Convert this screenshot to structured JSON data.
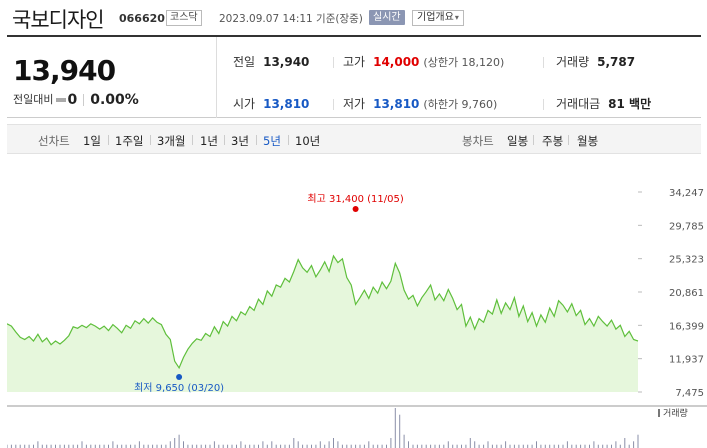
{
  "header": {
    "stock_name": "국보디자인",
    "stock_code": "066620",
    "market": "코스닥",
    "as_of": "2023.09.07 14:11 기준(장중)",
    "realtime_label": "실시간",
    "company_label": "기업개요"
  },
  "price": {
    "current": "13,940",
    "change_label": "전일대비",
    "change_value": "0",
    "change_pct": "0.00%"
  },
  "stats": {
    "prev_close": {
      "label": "전일",
      "value": "13,940"
    },
    "high": {
      "label": "고가",
      "value": "14,000",
      "sub": "(상한가 18,120)"
    },
    "volume": {
      "label": "거래량",
      "value": "5,787"
    },
    "open": {
      "label": "시가",
      "value": "13,810"
    },
    "low": {
      "label": "저가",
      "value": "13,810",
      "sub": "(하한가 9,760)"
    },
    "amount": {
      "label": "거래대금",
      "value": "81 백만"
    }
  },
  "line_chart": {
    "label": "선차트",
    "options": [
      "1일",
      "1주일",
      "3개월",
      "1년",
      "3년",
      "5년",
      "10년"
    ],
    "active": "5년"
  },
  "candle_chart": {
    "label": "봉차트",
    "options": [
      "일봉",
      "주봉",
      "월봉"
    ]
  },
  "colors": {
    "up": "#e00000",
    "down": "#1759c4",
    "line": "#5fbf3c",
    "area": "#e6f7dc"
  },
  "chart_data": {
    "type": "area",
    "series": [
      {
        "values": [
          16600,
          16300,
          15500,
          14800,
          14500,
          14900,
          14300,
          15200,
          14200,
          14700,
          13800,
          14300,
          13900,
          14400,
          15000,
          16200,
          16000,
          16400,
          16100,
          16600,
          16300,
          15900,
          16300,
          15700,
          16500,
          16000,
          15400,
          16400,
          16000,
          17000,
          16600,
          17300,
          16700,
          17400,
          16800,
          16500,
          15200,
          14500,
          11600,
          10700,
          12100,
          13200,
          14000,
          14600,
          14400,
          15300,
          14900,
          16200,
          15300,
          16900,
          16300,
          17600,
          17000,
          18200,
          17800,
          18900,
          18400,
          19900,
          19200,
          21000,
          20300,
          21800,
          21500,
          22700,
          22200,
          23600,
          25200,
          24100,
          23500,
          24400,
          22900,
          23800,
          24900,
          23600,
          25700,
          24800,
          25300,
          22800,
          21800,
          19200,
          20100,
          21100,
          20000,
          21500,
          20700,
          22200,
          21300,
          22300,
          24700,
          23400,
          21100,
          19900,
          20400,
          19000,
          20100,
          20900,
          21800,
          19800,
          20600,
          19700,
          21200,
          20000,
          18500,
          19200,
          16300,
          17500,
          15900,
          17300,
          16800,
          18400,
          17900,
          19800,
          18000,
          19400,
          18500,
          20100,
          17600,
          19000,
          16900,
          18100,
          16300,
          17800,
          16800,
          18700,
          17600,
          19700,
          19100,
          18200,
          19300,
          17700,
          18400,
          16500,
          17300,
          16300,
          17600,
          16900,
          16300,
          17100,
          15900,
          16400,
          14900,
          15600,
          14500,
          14300
        ],
        "min_point": {
          "index": 39,
          "label": "최저 9,650 (03/20)"
        },
        "max_point": {
          "index": 79,
          "label": "최고 31,400 (11/05)"
        }
      }
    ],
    "y_ticks": [
      "34,247",
      "29,785",
      "25,323",
      "20,861",
      "16,399",
      "11,937",
      "7,475"
    ],
    "ylim": [
      7475,
      34247
    ],
    "volume_label": "거래량",
    "volume_values": [
      1,
      1,
      1,
      1,
      1,
      1,
      1,
      2,
      1,
      1,
      1,
      1,
      1,
      1,
      1,
      1,
      1,
      2,
      1,
      1,
      1,
      1,
      1,
      1,
      2,
      1,
      1,
      1,
      1,
      1,
      2,
      1,
      1,
      1,
      1,
      1,
      1,
      2,
      3,
      4,
      2,
      1,
      1,
      1,
      1,
      1,
      1,
      2,
      1,
      1,
      1,
      1,
      1,
      2,
      1,
      1,
      1,
      1,
      2,
      1,
      2,
      1,
      1,
      1,
      1,
      3,
      2,
      1,
      1,
      1,
      1,
      2,
      1,
      2,
      3,
      2,
      1,
      1,
      1,
      1,
      1,
      1,
      2,
      1,
      1,
      1,
      1,
      3,
      12,
      10,
      4,
      2,
      1,
      1,
      1,
      1,
      1,
      1,
      1,
      1,
      2,
      1,
      1,
      1,
      1,
      3,
      2,
      1,
      1,
      2,
      1,
      1,
      1,
      2,
      1,
      1,
      1,
      1,
      1,
      1,
      2,
      1,
      1,
      1,
      1,
      1,
      1,
      2,
      1,
      1,
      1,
      1,
      1,
      2,
      1,
      1,
      1,
      1,
      2,
      1,
      3,
      1,
      2,
      4
    ],
    "grid": false
  }
}
